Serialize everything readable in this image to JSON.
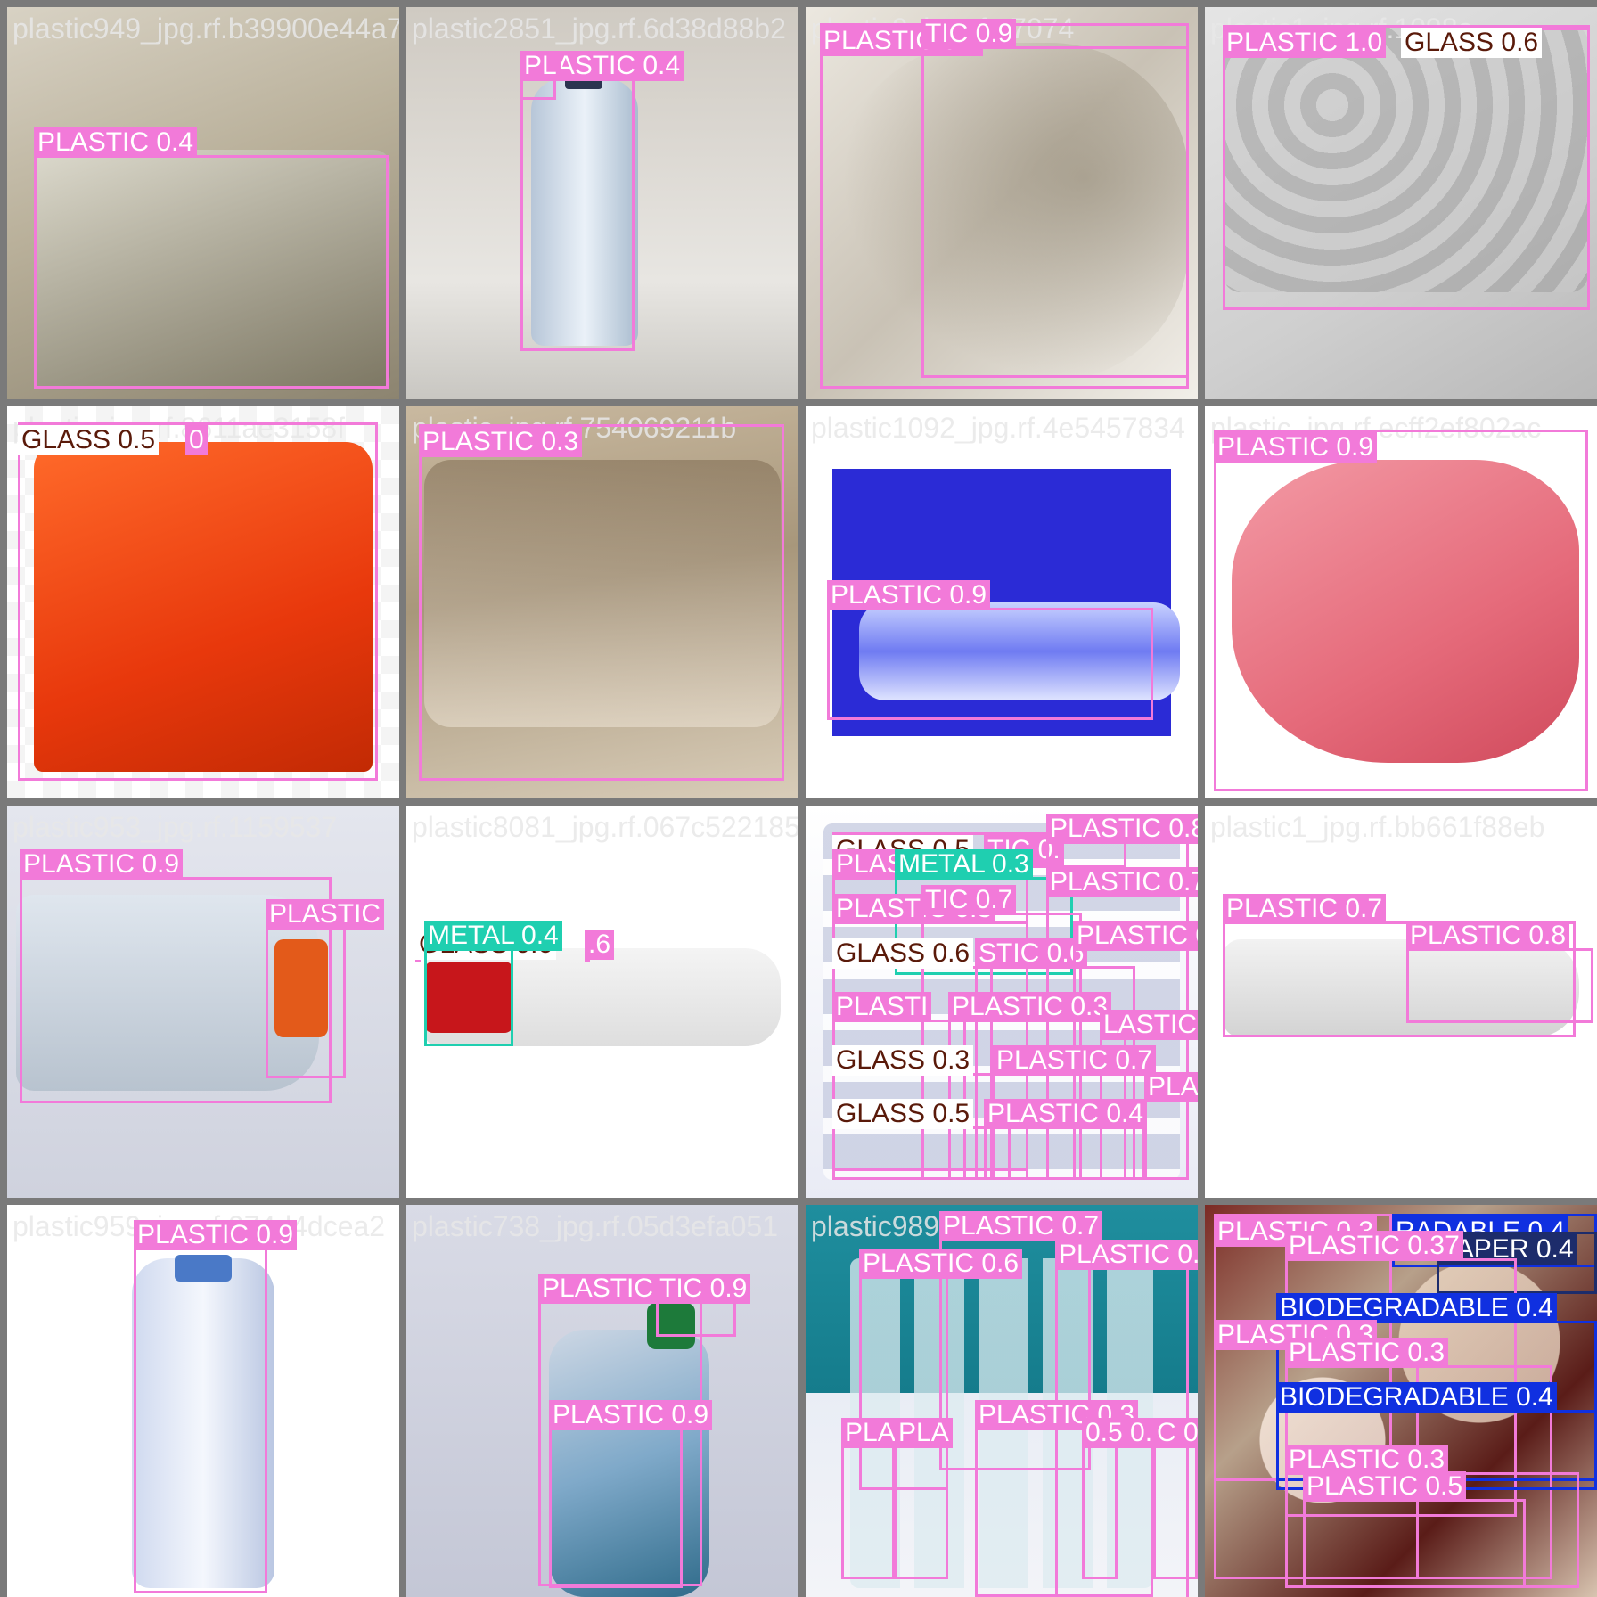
{
  "colors": {
    "plastic": "#f27ad9",
    "glass": "#ffffff",
    "glass_text": "#5a1a0a",
    "metal": "#1fcfb0",
    "paper": "#1d2c6b",
    "biodegradable": "#1030e0"
  },
  "tiles": [
    {
      "filename": "plastic949_jpg.rf.b39900e44a76402980af481",
      "scene": "clear plastic egg container",
      "detections": [
        {
          "label": "PLASTIC 0.4",
          "class": "plastic"
        }
      ]
    },
    {
      "filename": "plastic2851_jpg.rf.6d38d88b2",
      "scene": "water bottle",
      "detections": [
        {
          "label": "PLASTIC 0.4",
          "class": "plastic"
        },
        {
          "label": "PL",
          "class": "plastic"
        }
      ]
    },
    {
      "filename": "plastic0_jpg.rf.e7074",
      "scene": "plastic sheet",
      "detections": [
        {
          "label": "PLASTIC 0.4",
          "class": "plastic"
        },
        {
          "label": "TIC 0.9",
          "class": "plastic"
        }
      ]
    },
    {
      "filename": "plastic1_jpg.rf.1098a",
      "scene": "plastic egg tray",
      "detections": [
        {
          "label": "PLASTIC 1.0",
          "class": "plastic"
        },
        {
          "label": "GLASS 0.6",
          "class": "glass"
        }
      ]
    },
    {
      "filename": "plastic_jpg.rf.8611ae3158f",
      "scene": "orange plastic bag",
      "detections": [
        {
          "label": "GLASS 0.5",
          "class": "glass"
        },
        {
          "label": "0",
          "class": "plastic"
        }
      ]
    },
    {
      "filename": "plastic_jpg.rf.754069211b",
      "scene": "beige plastic",
      "detections": [
        {
          "label": "PLASTIC 0.3",
          "class": "plastic"
        }
      ]
    },
    {
      "filename": "plastic1092_jpg.rf.4e5457834",
      "scene": "bottle on blue",
      "detections": [
        {
          "label": "PLASTIC 0.9",
          "class": "plastic"
        }
      ]
    },
    {
      "filename": "plastic_jpg.rf.ecff2ef802ac",
      "scene": "pink thank you bag",
      "detections": [
        {
          "label": "PLASTIC 0.9",
          "class": "plastic"
        }
      ]
    },
    {
      "filename": "plastic953_jpg.rf.1159537",
      "scene": "crushed gatorade bottle",
      "detections": [
        {
          "label": "PLASTIC 0.9",
          "class": "plastic"
        },
        {
          "label": "PLASTIC",
          "class": "plastic"
        }
      ]
    },
    {
      "filename": "plastic8081_jpg.rf.067c522185",
      "scene": "bottle with red cap",
      "detections": [
        {
          "label": "GLASS 0.6",
          "class": "glass"
        },
        {
          "label": "METAL 0.4",
          "class": "metal"
        },
        {
          "label": ".6",
          "class": "plastic"
        }
      ]
    },
    {
      "filename": "",
      "scene": "many bottles",
      "detections": [
        {
          "label": "GLASS 0.5",
          "class": "glass"
        },
        {
          "label": "TIC 0.",
          "class": "plastic"
        },
        {
          "label": "PLASTIC 0.8",
          "class": "plastic"
        },
        {
          "label": "PLASTIC 0.5",
          "class": "plastic"
        },
        {
          "label": "METAL 0.3",
          "class": "metal"
        },
        {
          "label": "PLASTIC 0.7",
          "class": "plastic"
        },
        {
          "label": "PLASTIC 0.3",
          "class": "plastic"
        },
        {
          "label": "TIC 0.7",
          "class": "plastic"
        },
        {
          "label": "GLASS 0.6",
          "class": "glass"
        },
        {
          "label": "STIC 0.6",
          "class": "plastic"
        },
        {
          "label": "PLASTIC 0.7",
          "class": "plastic"
        },
        {
          "label": "PLASTI",
          "class": "plastic"
        },
        {
          "label": "PLASTIC 0.3",
          "class": "plastic"
        },
        {
          "label": "LASTIC 0.8",
          "class": "plastic"
        },
        {
          "label": "GLASS 0.3",
          "class": "glass"
        },
        {
          "label": "PLASTIC 0.7",
          "class": "plastic"
        },
        {
          "label": "PLASTIC 0.7",
          "class": "plastic"
        },
        {
          "label": "GLASS 0.5",
          "class": "glass"
        },
        {
          "label": "PLASTIC 0.4",
          "class": "plastic"
        }
      ]
    },
    {
      "filename": "plastic1_jpg.rf.bb661f88eb",
      "scene": "bottle lying",
      "detections": [
        {
          "label": "PLASTIC 0.7",
          "class": "plastic"
        },
        {
          "label": "PLASTIC 0.8",
          "class": "plastic"
        }
      ]
    },
    {
      "filename": "plastic959_jpg.rf.074d4dcea2",
      "scene": "crushed blue bottle",
      "detections": [
        {
          "label": "PLASTIC 0.9",
          "class": "plastic"
        }
      ]
    },
    {
      "filename": "plastic738_jpg.rf.05d3efa051",
      "scene": "green cap bottle",
      "detections": [
        {
          "label": "PLASTIC 0.8",
          "class": "plastic"
        },
        {
          "label": "TIC 0.9",
          "class": "plastic"
        },
        {
          "label": "PLASTIC 0.9",
          "class": "plastic"
        }
      ]
    },
    {
      "filename": "plastic9899",
      "scene": "bottles on teal",
      "detections": [
        {
          "label": "PLASTIC 0.7",
          "class": "plastic"
        },
        {
          "label": "PLASTIC 0.8",
          "class": "plastic"
        },
        {
          "label": "PLASTIC 0.6",
          "class": "plastic"
        },
        {
          "label": "PLASTIC 0.3",
          "class": "plastic"
        },
        {
          "label": "PLAS",
          "class": "plastic"
        },
        {
          "label": "PLA",
          "class": "plastic"
        },
        {
          "label": "0.5 0.6",
          "class": "plastic"
        },
        {
          "label": "C 0.8",
          "class": "plastic"
        }
      ]
    },
    {
      "filename": "",
      "scene": "mixed waste pile",
      "detections": [
        {
          "label": "PLASTIC 0.3",
          "class": "plastic"
        },
        {
          "label": "RADABLE 0.4",
          "class": "biodegradable"
        },
        {
          "label": "PAPER 0.4",
          "class": "paper"
        },
        {
          "label": "PLASTIC 0.37",
          "class": "plastic"
        },
        {
          "label": "BIODEGRADABLE 0.4",
          "class": "biodegradable"
        },
        {
          "label": "PLASTIC 0.3",
          "class": "plastic"
        },
        {
          "label": "PLASTIC 0.3",
          "class": "plastic"
        },
        {
          "label": "BIODEGRADABLE 0.4",
          "class": "biodegradable"
        },
        {
          "label": "PLASTIC 0.3",
          "class": "plastic"
        },
        {
          "label": "PLASTIC 0.5",
          "class": "plastic"
        }
      ]
    }
  ]
}
